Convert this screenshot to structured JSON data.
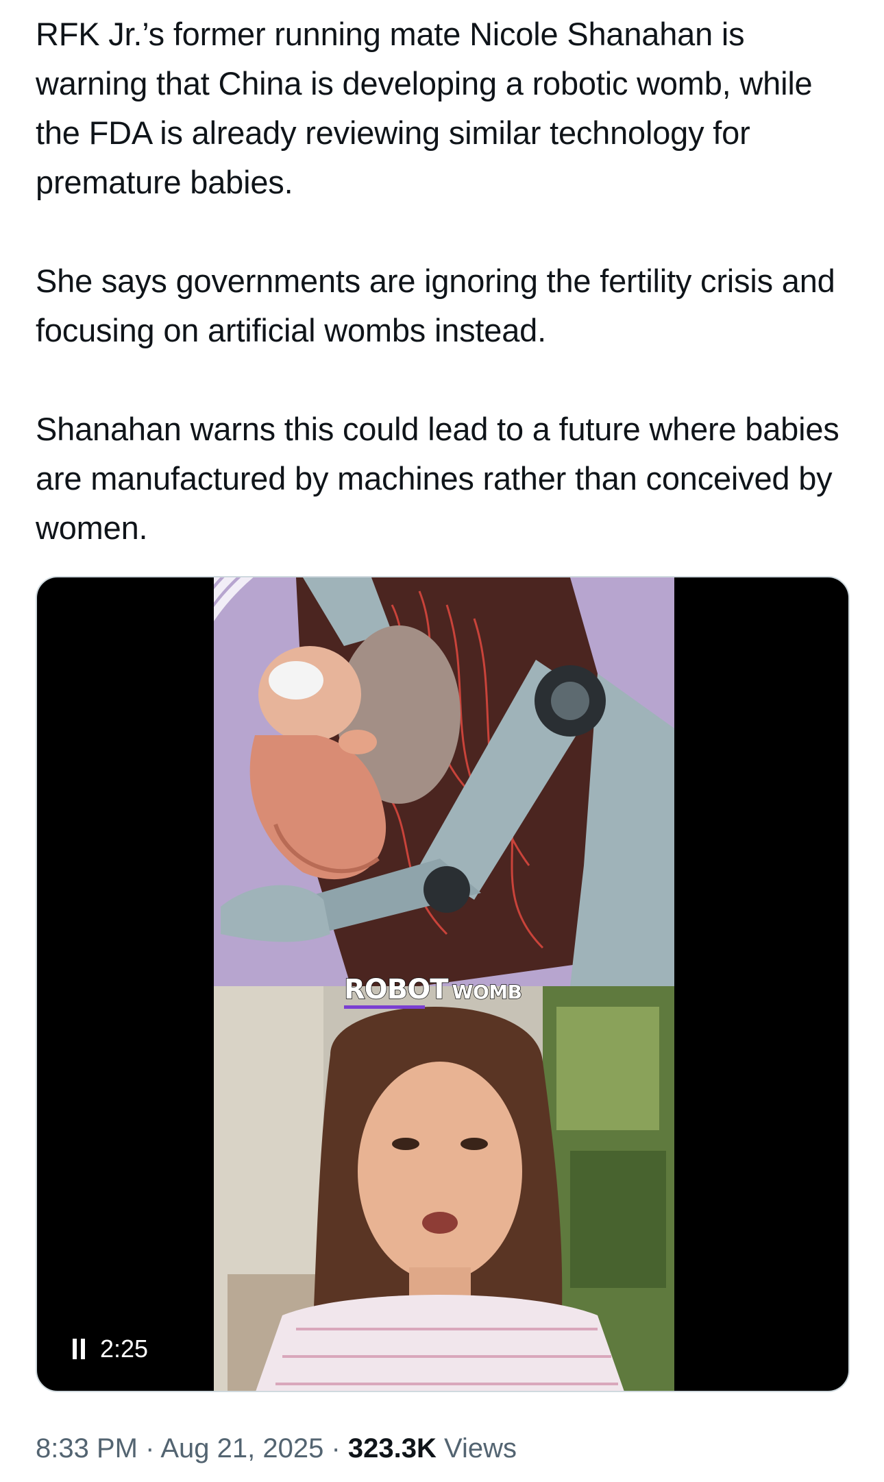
{
  "tweet": {
    "paragraphs": [
      "RFK Jr.’s former running mate Nicole Shanahan is warning that China is developing a robotic womb, while the FDA is already reviewing similar technology for premature babies.",
      "She says governments are ignoring the fertility crisis and focusing on artificial wombs instead.",
      "Shanahan warns this could lead to a future where babies are manufactured by machines rather than conceived by women."
    ]
  },
  "media": {
    "caption_big": "ROBOT",
    "caption_small": "WOMB",
    "caption_accent": "#7a3fd1",
    "duration": "2:25",
    "pause_icon": "pause-icon",
    "top_panel_bg": "#b7a5cf",
    "robot_color": "#9fb3b9"
  },
  "meta": {
    "time": "8:33 PM",
    "separator": "·",
    "date": "Aug 21, 2025",
    "views_count": "323.3K",
    "views_label": "Views"
  }
}
